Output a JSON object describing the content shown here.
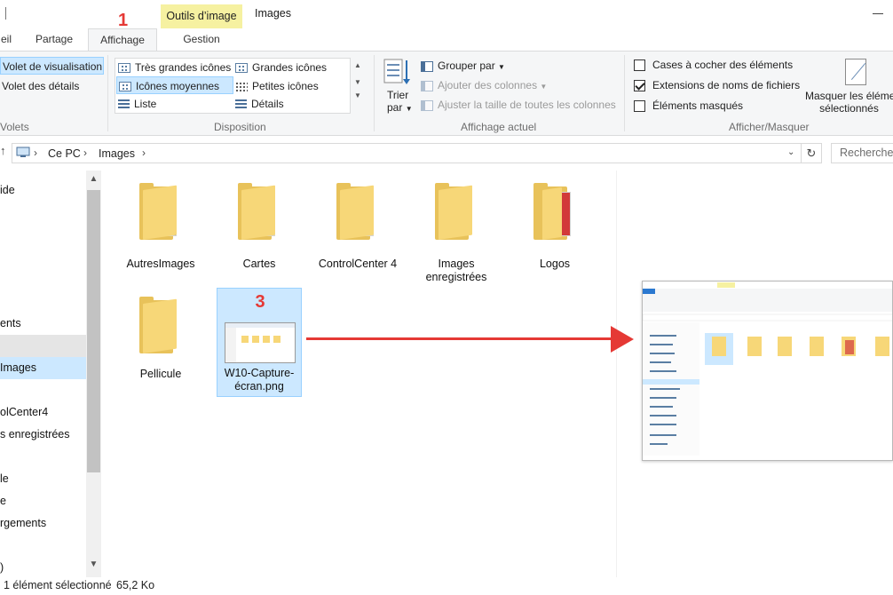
{
  "window": {
    "title": "Images",
    "contextual_tab_header": "Outils d’image"
  },
  "tabs": [
    {
      "label": "eil"
    },
    {
      "label": "Partage"
    },
    {
      "label": "Affichage"
    },
    {
      "label": "Gestion"
    }
  ],
  "annotations": {
    "step1": "1",
    "step3": "3"
  },
  "ribbon": {
    "panes": {
      "preview_pane": "Volet de visualisation",
      "details_pane": "Volet des détails",
      "group": "Volets"
    },
    "layout": {
      "items": [
        "Très grandes icônes",
        "Grandes icônes",
        "Icônes moyennes",
        "Petites icônes",
        "Liste",
        "Détails"
      ],
      "selected": "Icônes moyennes",
      "group": "Disposition"
    },
    "current_view": {
      "sort_by_line1": "Trier",
      "sort_by_line2": "par",
      "group_by": "Grouper par",
      "add_columns": "Ajouter des colonnes",
      "size_columns": "Ajuster la taille de toutes les colonnes",
      "group": "Affichage actuel"
    },
    "show_hide": {
      "item_checkboxes": "Cases à cocher des éléments",
      "item_checkboxes_checked": false,
      "file_extensions": "Extensions de noms de fichiers",
      "file_extensions_checked": true,
      "hidden_items": "Éléments masqués",
      "hidden_items_checked": false,
      "hide_selected_line1": "Masquer les éléme",
      "hide_selected_line2": "sélectionnés",
      "group": "Afficher/Masquer"
    }
  },
  "address": {
    "crumbs": [
      "Ce PC",
      "Images"
    ],
    "search_placeholder": "Recherchen"
  },
  "nav": {
    "items": [
      "ide",
      "ents",
      "Images",
      "olCenter4",
      "s enregistrées",
      "le",
      "e",
      "rgements",
      ")"
    ]
  },
  "files": [
    {
      "name": "AutresImages"
    },
    {
      "name": "Cartes"
    },
    {
      "name": "ControlCenter 4"
    },
    {
      "name": "Images enregistrées"
    },
    {
      "name": "Logos"
    },
    {
      "name": "Pellicule"
    },
    {
      "name": "W10-Capture-écran.png"
    }
  ],
  "status": {
    "selection": "1 élément sélectionné",
    "size": "65,2 Ko"
  },
  "colors": {
    "accent_selection": "#cce8ff",
    "contextual_header": "#f6f1a1",
    "annotation_red": "#e53935",
    "folder_yellow": "#f7d778"
  }
}
